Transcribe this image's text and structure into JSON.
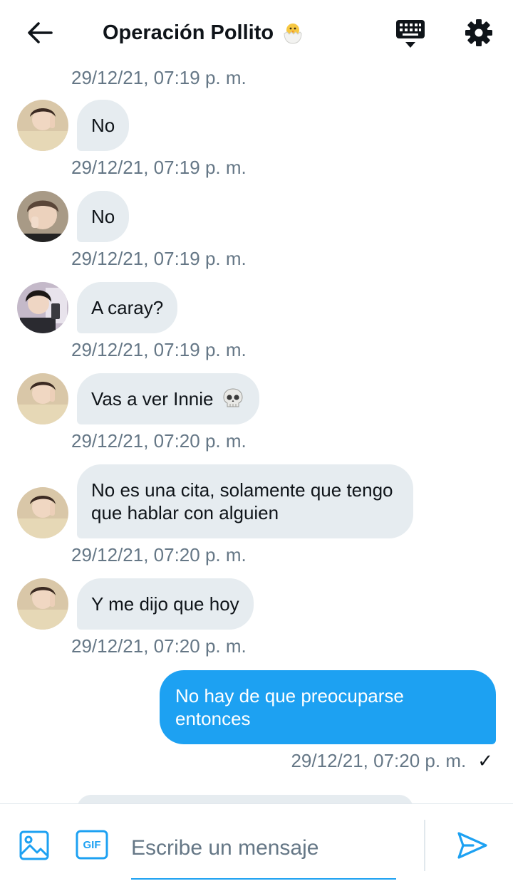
{
  "header": {
    "title": "Operación Pollito",
    "title_emoji": "hatching-chick",
    "back_icon": "arrow-left-icon",
    "keyboard_icon": "keyboard-icon",
    "settings_icon": "gear-icon"
  },
  "top_timestamp": "29/12/21, 07:19 p. m.",
  "messages": [
    {
      "text": "No",
      "time": "29/12/21, 07:19 p. m."
    },
    {
      "text": "No",
      "time": "29/12/21, 07:19 p. m."
    },
    {
      "text": "A caray?",
      "time": "29/12/21, 07:19 p. m."
    },
    {
      "text": "Vas a ver Innie",
      "emoji": "skull",
      "time": "29/12/21, 07:20 p. m."
    },
    {
      "text": "No es una cita, solamente que tengo que hablar con alguien",
      "time": "29/12/21, 07:20 p. m."
    },
    {
      "text": "Y me dijo que hoy",
      "time": "29/12/21, 07:20 p. m."
    }
  ],
  "outgoing": {
    "text": "No hay de que preocuparse entonces",
    "time": "29/12/21, 07:20 p. m.",
    "check": "✓"
  },
  "composer": {
    "placeholder": "Escribe un mensaje",
    "gif_label": "GIF",
    "image_icon": "image-icon",
    "send_icon": "send-icon"
  },
  "colors": {
    "accent": "#1da1f2",
    "bubble_in": "#e6ecf0",
    "secondary_text": "#657786"
  }
}
